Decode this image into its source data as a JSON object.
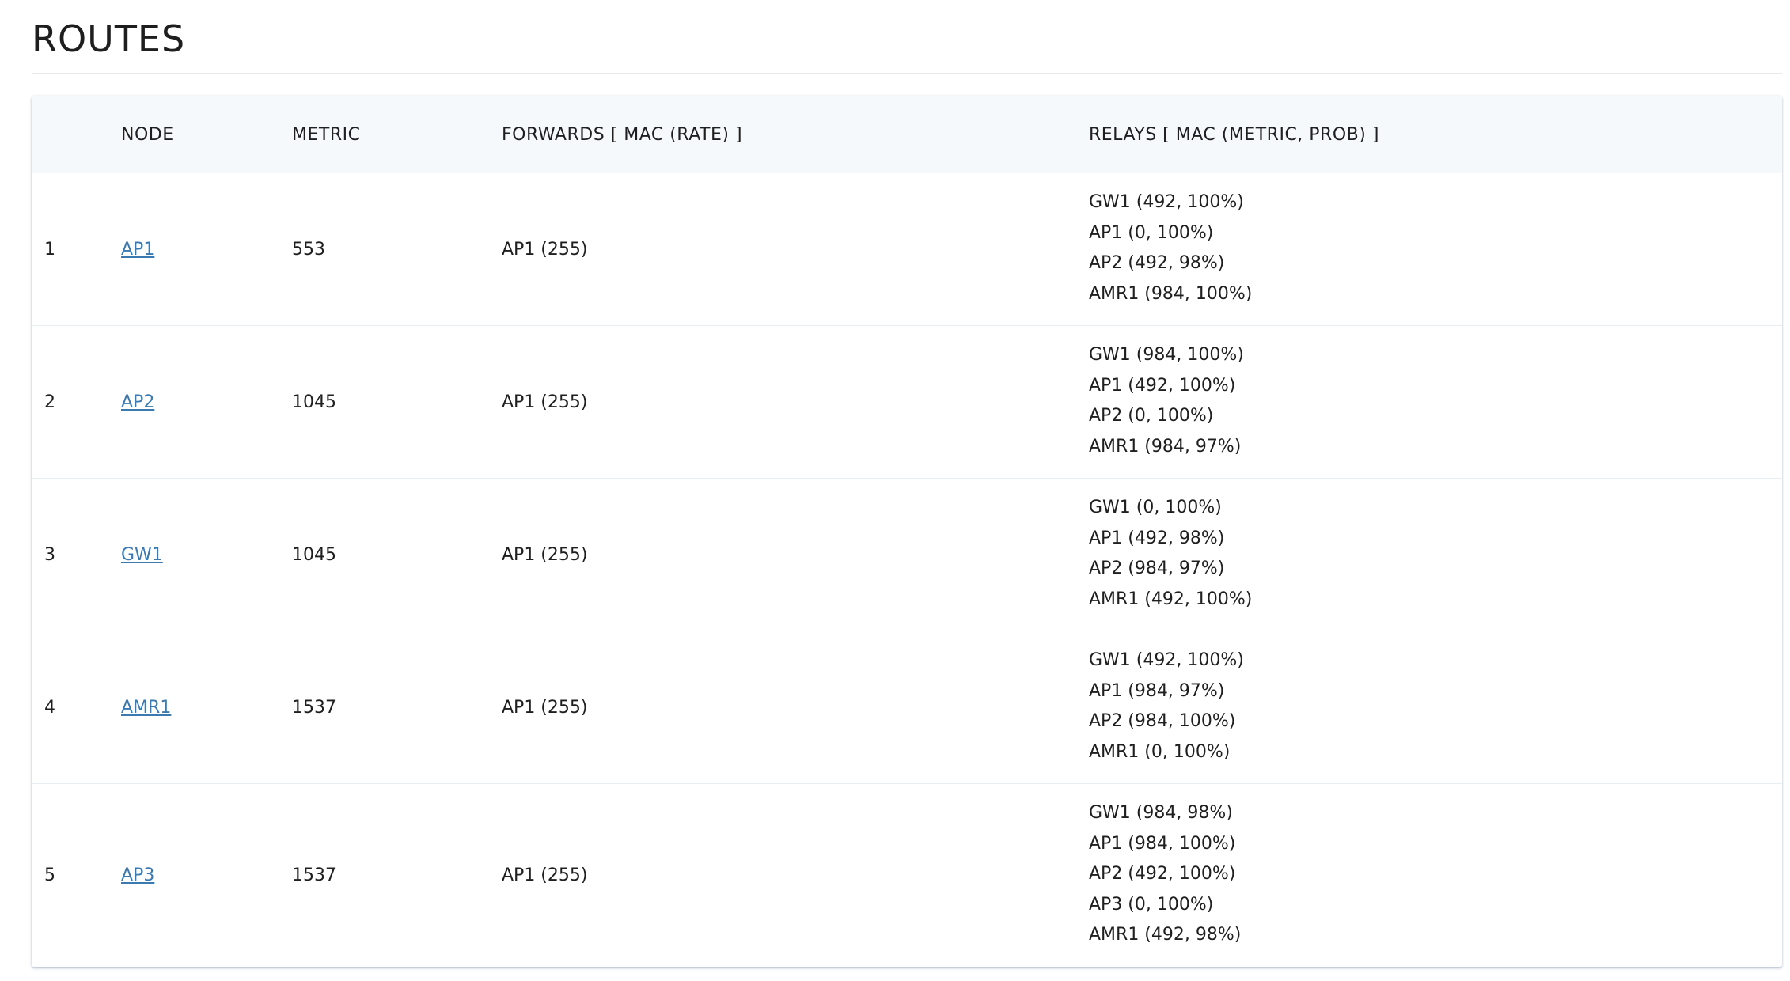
{
  "page": {
    "title": "ROUTES"
  },
  "table": {
    "headers": {
      "index": "",
      "node": "NODE",
      "metric": "METRIC",
      "forwards": "FORWARDS [ MAC (RATE) ]",
      "relays": "RELAYS [ MAC (METRIC, PROB) ]"
    },
    "rows": [
      {
        "index": "1",
        "node": "AP1",
        "metric": "553",
        "forwards": "AP1 (255)",
        "relays": [
          "GW1 (492, 100%)",
          "AP1 (0, 100%)",
          "AP2 (492, 98%)",
          "AMR1 (984, 100%)"
        ]
      },
      {
        "index": "2",
        "node": "AP2",
        "metric": "1045",
        "forwards": "AP1 (255)",
        "relays": [
          "GW1 (984, 100%)",
          "AP1 (492, 100%)",
          "AP2 (0, 100%)",
          "AMR1 (984, 97%)"
        ]
      },
      {
        "index": "3",
        "node": "GW1",
        "metric": "1045",
        "forwards": "AP1 (255)",
        "relays": [
          "GW1 (0, 100%)",
          "AP1 (492, 98%)",
          "AP2 (984, 97%)",
          "AMR1 (492, 100%)"
        ]
      },
      {
        "index": "4",
        "node": "AMR1",
        "metric": "1537",
        "forwards": "AP1 (255)",
        "relays": [
          "GW1 (492, 100%)",
          "AP1 (984, 97%)",
          "AP2 (984, 100%)",
          "AMR1 (0, 100%)"
        ]
      },
      {
        "index": "5",
        "node": "AP3",
        "metric": "1537",
        "forwards": "AP1 (255)",
        "relays": [
          "GW1 (984, 98%)",
          "AP1 (984, 100%)",
          "AP2 (492, 100%)",
          "AP3 (0, 100%)",
          "AMR1 (492, 98%)"
        ]
      }
    ]
  },
  "colors": {
    "link": "#3a7ab0",
    "header_bg": "#f5f9fc",
    "text": "#1f1f1f"
  }
}
